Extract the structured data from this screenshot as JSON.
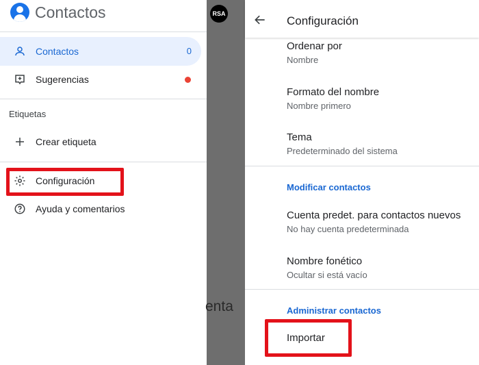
{
  "drawer": {
    "app_title": "Contactos",
    "items": [
      {
        "label": "Contactos",
        "count": "0",
        "icon": "person-icon",
        "active": true
      },
      {
        "label": "Sugerencias",
        "icon": "suggestion-icon",
        "badge_color": "#ea4335"
      },
      {
        "label": "Crear etiqueta",
        "icon": "plus-icon"
      },
      {
        "label": "Configuración",
        "icon": "gear-icon"
      },
      {
        "label": "Ayuda y comentarios",
        "icon": "help-icon"
      }
    ],
    "section_label": "Etiquetas"
  },
  "background": {
    "partial_text": "enta",
    "avatar_text": "RSA"
  },
  "settings": {
    "title": "Configuración",
    "items": [
      {
        "title": "Ordenar por",
        "subtitle": "Nombre"
      },
      {
        "title": "Formato del nombre",
        "subtitle": "Nombre primero"
      },
      {
        "title": "Tema",
        "subtitle": "Predeterminado del sistema"
      }
    ],
    "sections": [
      {
        "header": "Modificar contactos",
        "items": [
          {
            "title": "Cuenta predet. para contactos nuevos",
            "subtitle": "No hay cuenta predeterminada"
          },
          {
            "title": "Nombre fonético",
            "subtitle": "Ocultar si está vacío"
          }
        ]
      },
      {
        "header": "Administrar contactos",
        "items": [
          {
            "title": "Importar"
          }
        ]
      }
    ]
  },
  "colors": {
    "accent": "#1a73e8",
    "active_bg": "#e8f0fe",
    "highlight": "#e3121a",
    "scrim": "#6e6e6e"
  }
}
